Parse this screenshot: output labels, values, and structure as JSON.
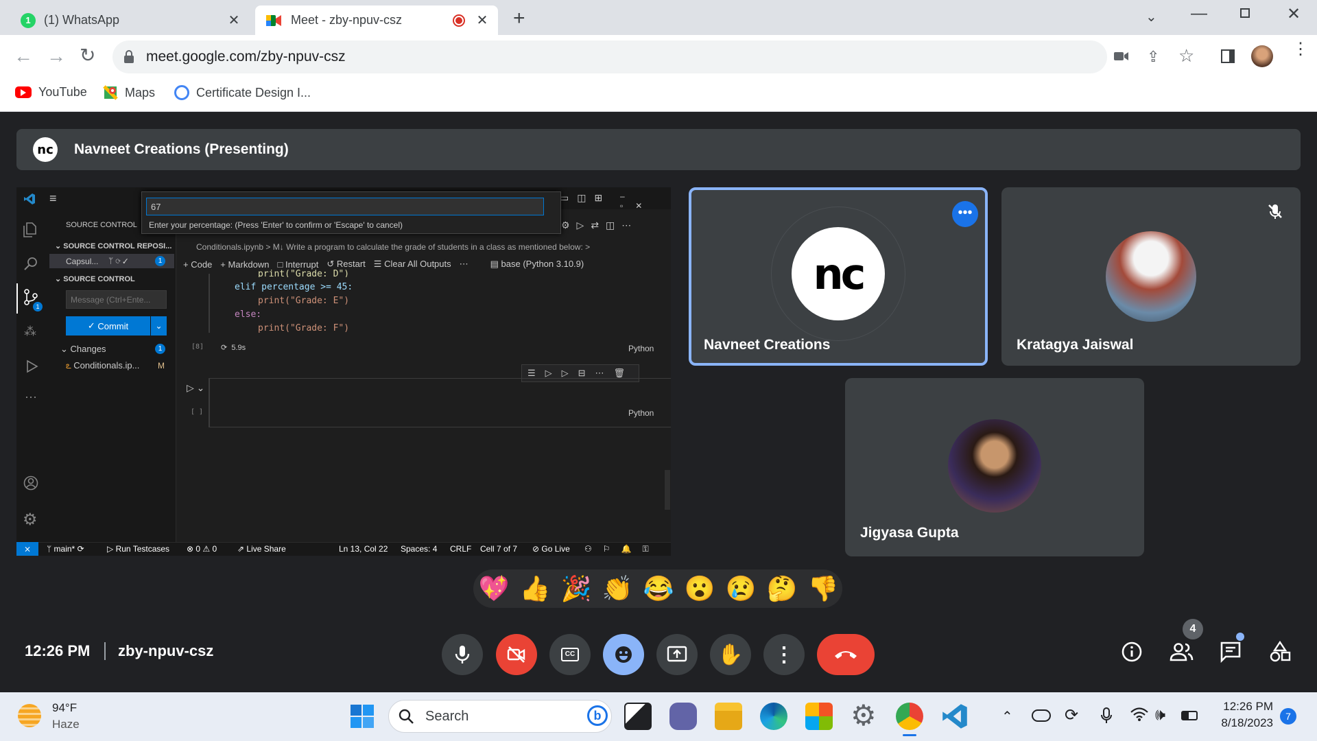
{
  "browser": {
    "tabs": [
      {
        "title": "(1) WhatsApp",
        "badge": "1"
      },
      {
        "title": "Meet - zby-npuv-csz"
      }
    ],
    "url": "meet.google.com/zby-npuv-csz",
    "bookmarks": [
      "YouTube",
      "Maps",
      "Certificate Design I..."
    ]
  },
  "meet": {
    "banner_initials": "nc",
    "banner_title": "Navneet Creations (Presenting)",
    "participants": [
      {
        "name": "Navneet Creations",
        "avatar_text": "nc"
      },
      {
        "name": "Kratagya Jaiswal"
      },
      {
        "name": "Jigyasa Gupta"
      }
    ],
    "emojis": [
      "💖",
      "👍",
      "🎉",
      "👏",
      "😂",
      "😮",
      "😢",
      "🤔",
      "👎"
    ],
    "time": "12:26 PM",
    "meeting_code": "zby-npuv-csz",
    "people_count": "4"
  },
  "vscode": {
    "input_value": "67",
    "input_hint": "Enter your percentage: (Press 'Enter' to confirm or 'Escape' to cancel)",
    "sidebar_title": "SOURCE CONTROL",
    "repos_title": "SOURCE CONTROL REPOSI...",
    "repo_name": "Capsul...",
    "repo_badge": "1",
    "sc_title": "SOURCE CONTROL",
    "message_placeholder": "Message (Ctrl+Ente...",
    "commit_label": "Commit",
    "changes_label": "Changes",
    "changes_count": "1",
    "changed_file": "Conditionals.ip...",
    "changed_file_status": "M",
    "breadcrumb_file": "Conditionals.ipynb",
    "breadcrumb_md": "M↓",
    "breadcrumb_cell": "Write a program to calculate the grade of students in a class as mentioned below:",
    "nb_toolbar": [
      "Code",
      "Markdown",
      "Interrupt",
      "Restart",
      "Clear All Outputs"
    ],
    "kernel": "base (Python 3.10.9)",
    "code_lines": [
      "print(\"Grade: D\")",
      "elif percentage >= 45:",
      "print(\"Grade: E\")",
      "else:",
      "print(\"Grade: F\")"
    ],
    "exec_count": "[8]",
    "exec_time": "5.9s",
    "lang": "Python",
    "empty_exec": "[ ]",
    "status": {
      "branch": "main*",
      "run": "Run Testcases",
      "problems": "⊗ 0 ⚠ 0",
      "liveshare": "Live Share",
      "pos": "Ln 13, Col 22",
      "spaces": "Spaces: 4",
      "eol": "CRLF",
      "cell": "Cell 7 of 7",
      "golive": "Go Live"
    }
  },
  "taskbar": {
    "temp": "94°F",
    "weather": "Haze",
    "search": "Search",
    "time": "12:26 PM",
    "date": "8/18/2023",
    "notif": "7"
  }
}
